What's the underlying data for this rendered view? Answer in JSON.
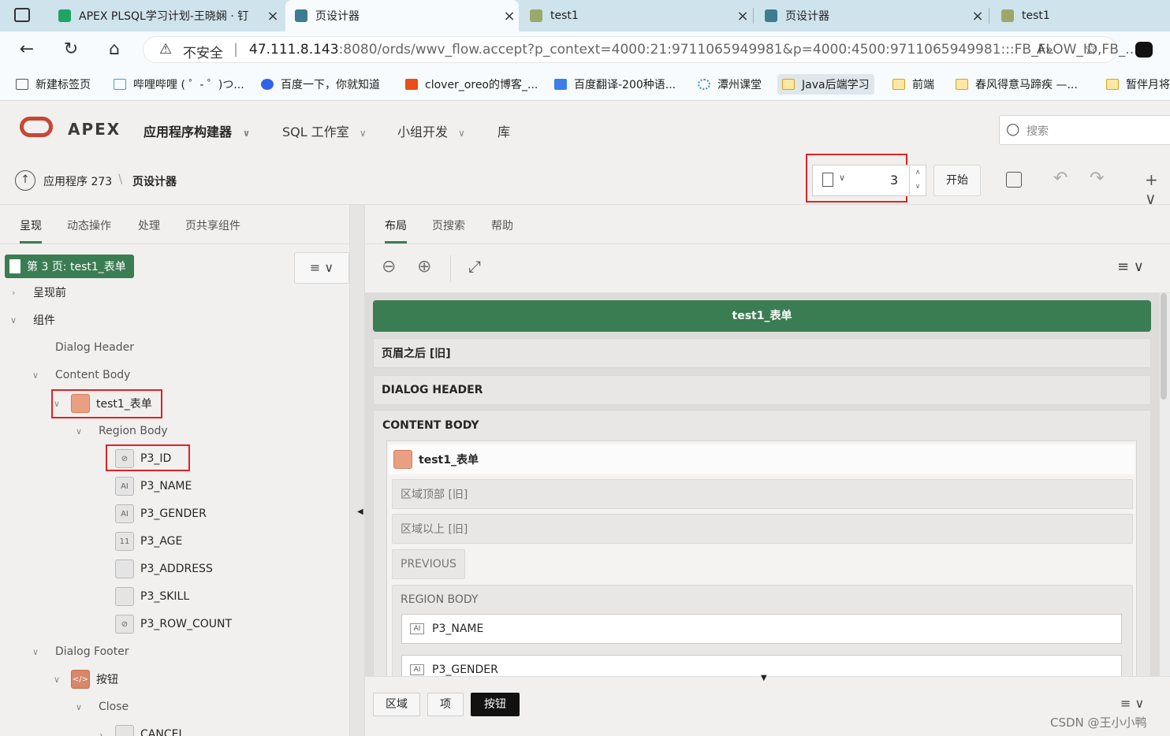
{
  "browser": {
    "tabs": [
      {
        "title": "APEX PLSQL学习计划-王晓娴 · 钉",
        "favicon_color": "#1fa463"
      },
      {
        "title": "页设计器",
        "favicon_color": "#3d7c93"
      },
      {
        "title": "test1",
        "favicon_color": "#9aa86b"
      },
      {
        "title": "页设计器",
        "favicon_color": "#3d7c93"
      },
      {
        "title": "test1",
        "favicon_color": "#9aa86b"
      }
    ],
    "security_label": "不安全",
    "url_host": "47.111.8.143",
    "url_rest": ":8080/ords/wwv_flow.accept?p_context=4000:21:9711065949981&p=4000:4500:9711065949981:::FB_FLOW_ID,FB_...",
    "bookmarks": [
      {
        "label": "新建标签页",
        "color": "#555555"
      },
      {
        "label": "哔哩哔哩 ( ゜- ゜)つ...",
        "color": "#2fa5e0"
      },
      {
        "label": "百度一下，你就知道",
        "color": "#3064e8"
      },
      {
        "label": "clover_oreo的博客_...",
        "color": "#e94e1b"
      },
      {
        "label": "百度翻译-200种语...",
        "color": "#3a7ee8"
      },
      {
        "label": "潭州课堂",
        "color": "#3a8be0"
      },
      {
        "label": "Java后端学习",
        "color": "#d7a21b"
      },
      {
        "label": "前端",
        "color": "#d7a21b"
      },
      {
        "label": "春风得意马蹄疾 —...",
        "color": "#d7a21b"
      },
      {
        "label": "暂伴月将",
        "color": "#d7a21b"
      }
    ]
  },
  "apex": {
    "logo": "APEX",
    "menus": [
      "应用程序构建器",
      "SQL 工作室",
      "小组开发",
      "库"
    ],
    "search_placeholder": "搜索",
    "breadcrumb": {
      "app": "应用程序 273",
      "page": "页设计器"
    },
    "page_number": "3",
    "go_label": "开始"
  },
  "left": {
    "tabs": [
      "呈现",
      "动态操作",
      "处理",
      "页共享组件"
    ],
    "page_badge": "第 3 页: test1_表单",
    "tree": {
      "before_render": "呈现前",
      "components": "组件",
      "dialog_header": "Dialog Header",
      "content_body": "Content Body",
      "region": "test1_表单",
      "region_body": "Region Body",
      "items": [
        "P3_ID",
        "P3_NAME",
        "P3_GENDER",
        "P3_AGE",
        "P3_ADDRESS",
        "P3_SKILL",
        "P3_ROW_COUNT"
      ],
      "dialog_footer": "Dialog Footer",
      "buttons": "按钮",
      "close": "Close",
      "cancel": "CANCEL"
    }
  },
  "right": {
    "tabs": [
      "布局",
      "页搜索",
      "帮助"
    ],
    "page_title": "test1_表单",
    "after_header": "页眉之后 [旧]",
    "dialog_header": "DIALOG HEADER",
    "content_body": "CONTENT BODY",
    "region_title": "test1_表单",
    "region_top": "区域顶部 [旧]",
    "region_above": "区域以上 [旧]",
    "previous": "PREVIOUS",
    "region_body": "REGION BODY",
    "fields": [
      "P3_NAME",
      "P3_GENDER"
    ],
    "bottom_tabs": [
      "区域",
      "项",
      "按钮"
    ],
    "accent": "#3a7d52"
  },
  "watermark": "CSDN @王小小鸭"
}
